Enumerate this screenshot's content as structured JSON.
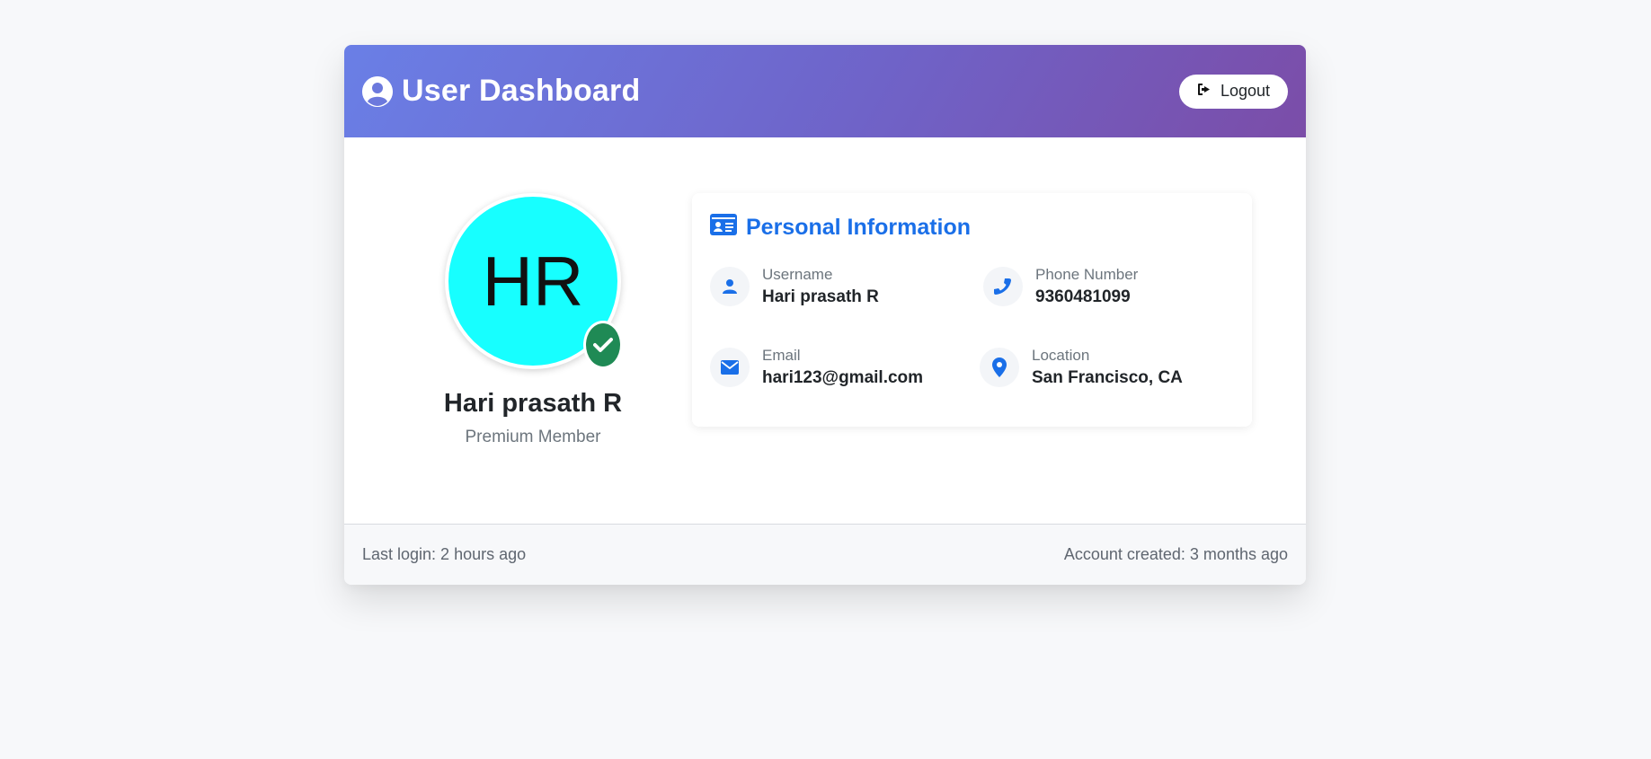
{
  "header": {
    "title": "User Dashboard",
    "icon": "user-circle-icon",
    "logout_label": "Logout",
    "logout_icon": "sign-out-icon"
  },
  "profile": {
    "initials": "HR",
    "name": "Hari prasath R",
    "role": "Premium Member",
    "avatar_color": "#17ffff",
    "verified_icon": "check-badge-icon"
  },
  "info": {
    "title": "Personal Information",
    "title_icon": "id-card-icon",
    "fields": [
      {
        "label": "Username",
        "value": "Hari prasath R",
        "icon": "user-icon"
      },
      {
        "label": "Phone Number",
        "value": "9360481099",
        "icon": "phone-icon"
      },
      {
        "label": "Email",
        "value": "hari123@gmail.com",
        "icon": "envelope-icon"
      },
      {
        "label": "Location",
        "value": "San Francisco, CA",
        "icon": "location-pin-icon"
      }
    ]
  },
  "footer": {
    "last_login": "Last login: 2 hours ago",
    "account_created": "Account created: 3 months ago"
  },
  "colors": {
    "accent": "#1a6fe8",
    "header_gradient_start": "#6a7fe6",
    "header_gradient_end": "#7b4da8",
    "verified": "#1f8a55"
  }
}
